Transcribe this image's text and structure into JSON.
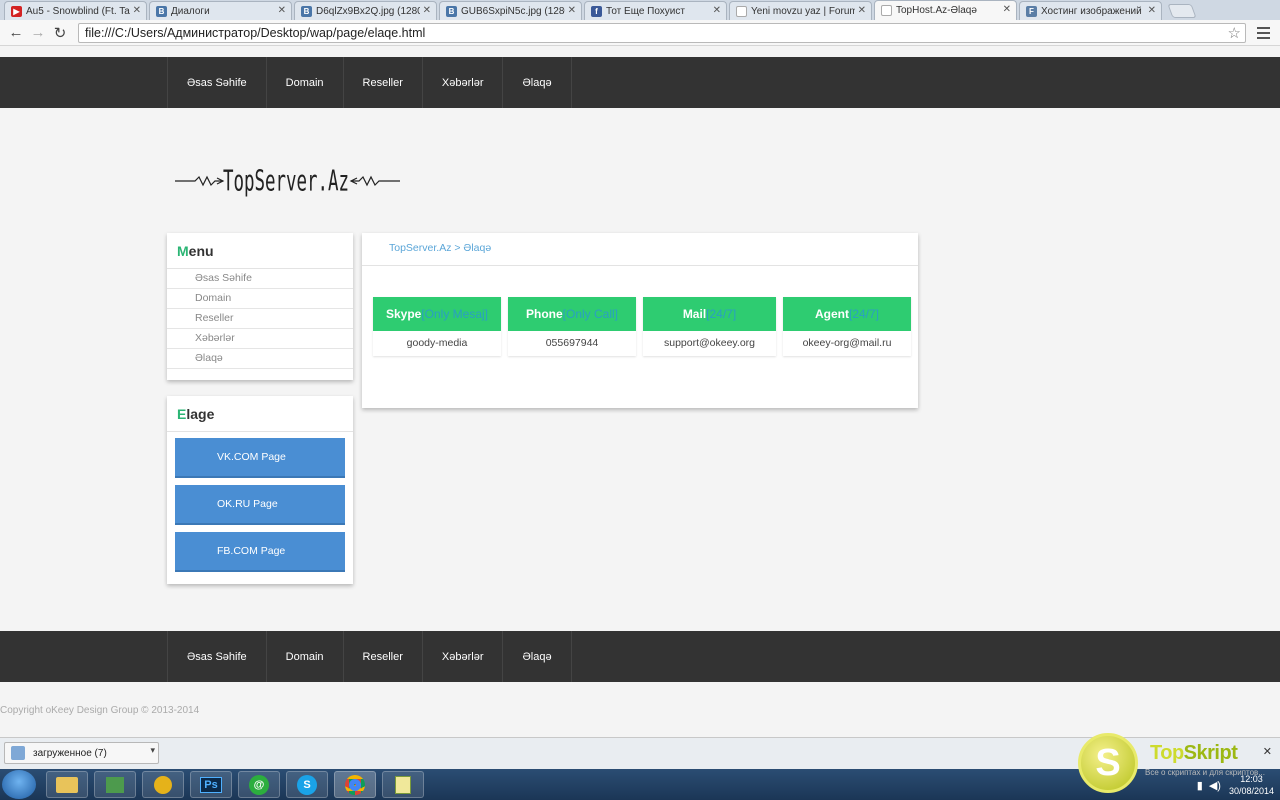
{
  "browser": {
    "tabs": [
      {
        "label": "Au5 - Snowblind (Ft. Tash",
        "icon": "youtube-icon",
        "color": "#d32323",
        "glyph": "▶"
      },
      {
        "label": "Диалоги",
        "icon": "vk-icon",
        "color": "#4a76a8",
        "glyph": "B"
      },
      {
        "label": "D6qlZx9Bx2Q.jpg (1280×8",
        "icon": "vk-icon",
        "color": "#4a76a8",
        "glyph": "B"
      },
      {
        "label": "GUB6SxpiN5c.jpg (1280×8",
        "icon": "vk-icon",
        "color": "#4a76a8",
        "glyph": "B"
      },
      {
        "label": "Тот Еще Похуист",
        "icon": "facebook-icon",
        "color": "#3b5998",
        "glyph": "f"
      },
      {
        "label": "Yeni movzu yaz | Forum.A",
        "icon": "page-icon",
        "color": "#cccccc",
        "glyph": ""
      },
      {
        "label": "TopHost.Az-Əlaqə",
        "icon": "page-icon",
        "color": "#cccccc",
        "glyph": ""
      },
      {
        "label": "Хостинг изображений Fa",
        "icon": "fastpic-icon",
        "color": "#5a7ea6",
        "glyph": "F"
      }
    ],
    "active_tab": 6,
    "close_glyph": "✕",
    "url": "file:///C:/Users/Администратор/Desktop/wap/page/elaqe.html",
    "back_glyph": "←",
    "forward_glyph": "→",
    "reload_glyph": "↻",
    "star_glyph": "☆"
  },
  "nav": {
    "items": [
      "Əsas Səhife",
      "Domain",
      "Reseller",
      "Xəbərlər",
      "Əlaqə"
    ]
  },
  "logo": {
    "text": "TopServer.Az"
  },
  "menu_card": {
    "title_first": "M",
    "title_rest": "enu",
    "items": [
      "Əsas Səhife",
      "Domain",
      "Reseller",
      "Xəbərlər",
      "Əlaqə"
    ]
  },
  "elage_card": {
    "title_first": "E",
    "title_rest": "lage",
    "buttons": [
      "VK.COM Page",
      "OK.RU Page",
      "FB.COM Page"
    ]
  },
  "content": {
    "breadcrumb": "TopServer.Az > Əlaqə",
    "contacts": [
      {
        "label": "Skype",
        "tag": "[Only Mesaj]",
        "value": "goody-media"
      },
      {
        "label": "Phone",
        "tag": "[Only Call]",
        "value": "055697944"
      },
      {
        "label": "Mail",
        "tag": "[24/7]",
        "value": "support@okeey.org"
      },
      {
        "label": "Agent",
        "tag": "[24/7]",
        "value": "okeey-org@mail.ru"
      }
    ]
  },
  "footer": {
    "copyright": "Copyright oKeey Design Group © 2013-2014"
  },
  "downloads": {
    "label": "загруженное (7)",
    "arrow": "▾",
    "close": "✕"
  },
  "taskbar": {
    "items": [
      "",
      "",
      "",
      "Ps",
      "@",
      "S",
      "",
      ""
    ],
    "time": "12:03",
    "date": "30/08/2014"
  },
  "watermark": {
    "letter": "S",
    "brand_a": "Top",
    "brand_b": "Skript",
    "sub": "Все о скриптах и для скриптов..."
  },
  "colors": {
    "nav_bg": "#333333",
    "accent_green": "#2ecc71",
    "button_blue": "#4a8ed3",
    "link_blue": "#5ba6d8"
  }
}
